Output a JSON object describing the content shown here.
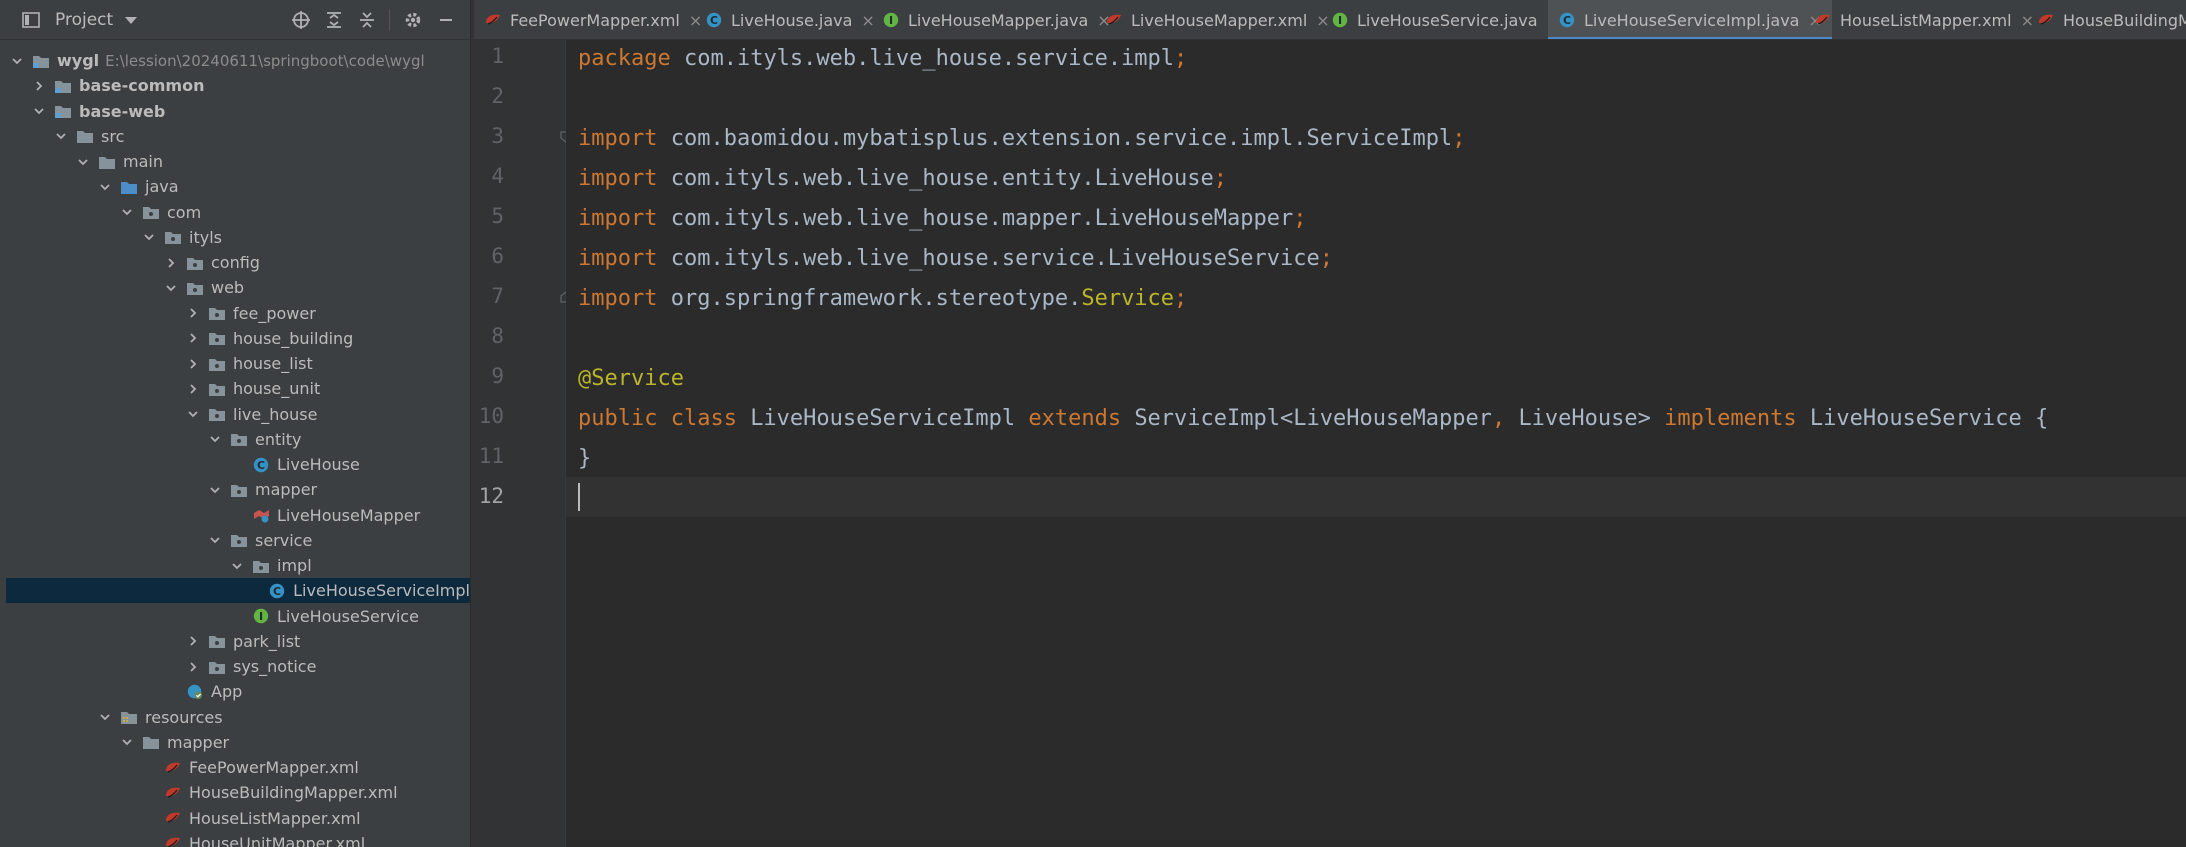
{
  "project_panel": {
    "title": "Project",
    "tree": [
      {
        "label": "wygl",
        "path": "E:\\lession\\20240611\\springboot\\code\\wygl",
        "bold": true,
        "expanded": true,
        "icon": "module-folder-icon"
      },
      {
        "label": "base-common",
        "bold": true,
        "expanded": false,
        "icon": "module-folder-icon"
      },
      {
        "label": "base-web",
        "bold": true,
        "expanded": true,
        "icon": "module-folder-icon"
      },
      {
        "label": "src",
        "expanded": true,
        "icon": "folder-icon"
      },
      {
        "label": "main",
        "expanded": true,
        "icon": "folder-icon"
      },
      {
        "label": "java",
        "expanded": true,
        "icon": "source-folder-icon"
      },
      {
        "label": "com",
        "expanded": true,
        "icon": "package-icon"
      },
      {
        "label": "ityls",
        "expanded": true,
        "icon": "package-icon"
      },
      {
        "label": "config",
        "expanded": false,
        "icon": "package-icon"
      },
      {
        "label": "web",
        "expanded": true,
        "icon": "package-icon"
      },
      {
        "label": "fee_power",
        "expanded": false,
        "icon": "package-icon"
      },
      {
        "label": "house_building",
        "expanded": false,
        "icon": "package-icon"
      },
      {
        "label": "house_list",
        "expanded": false,
        "icon": "package-icon"
      },
      {
        "label": "house_unit",
        "expanded": false,
        "icon": "package-icon"
      },
      {
        "label": "live_house",
        "expanded": true,
        "icon": "package-icon"
      },
      {
        "label": "entity",
        "expanded": true,
        "icon": "package-icon"
      },
      {
        "label": "LiveHouse",
        "icon": "java-class-icon"
      },
      {
        "label": "mapper",
        "expanded": true,
        "icon": "package-icon"
      },
      {
        "label": "LiveHouseMapper",
        "icon": "mapper-interface-icon"
      },
      {
        "label": "service",
        "expanded": true,
        "icon": "package-icon"
      },
      {
        "label": "impl",
        "expanded": true,
        "icon": "package-icon"
      },
      {
        "label": "LiveHouseServiceImpl",
        "icon": "java-class-icon",
        "selected": true
      },
      {
        "label": "LiveHouseService",
        "icon": "java-interface-icon"
      },
      {
        "label": "park_list",
        "expanded": false,
        "icon": "package-icon"
      },
      {
        "label": "sys_notice",
        "expanded": false,
        "icon": "package-icon"
      },
      {
        "label": "App",
        "icon": "spring-boot-app-icon"
      },
      {
        "label": "resources",
        "expanded": true,
        "icon": "resources-folder-icon"
      },
      {
        "label": "mapper",
        "expanded": true,
        "icon": "folder-icon"
      },
      {
        "label": "FeePowerMapper.xml",
        "icon": "mybatis-xml-icon"
      },
      {
        "label": "HouseBuildingMapper.xml",
        "icon": "mybatis-xml-icon"
      },
      {
        "label": "HouseListMapper.xml",
        "icon": "mybatis-xml-icon"
      },
      {
        "label": "HouseUnitMapper.xml",
        "icon": "mybatis-xml-icon"
      }
    ]
  },
  "editor_tabs": [
    {
      "label": "FeePowerMapper.xml",
      "icon": "mybatis-xml-icon"
    },
    {
      "label": "LiveHouse.java",
      "icon": "java-class-icon"
    },
    {
      "label": "LiveHouseMapper.java",
      "icon": "java-interface-icon"
    },
    {
      "label": "LiveHouseMapper.xml",
      "icon": "mybatis-xml-icon"
    },
    {
      "label": "LiveHouseService.java",
      "icon": "java-interface-icon"
    },
    {
      "label": "LiveHouseServiceImpl.java",
      "icon": "java-class-icon",
      "active": true
    },
    {
      "label": "HouseListMapper.xml",
      "icon": "mybatis-xml-icon"
    },
    {
      "label": "HouseBuildingMapper.xml",
      "icon": "mybatis-xml-icon"
    }
  ],
  "editor": {
    "current_line": 12,
    "lines": [
      {
        "n": "1",
        "tokens": [
          {
            "t": "package ",
            "c": "kw"
          },
          {
            "t": "com.ityls.web.live_house.service.impl",
            "c": "txt"
          },
          {
            "t": ";",
            "c": "punc"
          }
        ]
      },
      {
        "n": "2",
        "tokens": []
      },
      {
        "n": "3",
        "tokens": [
          {
            "t": "import ",
            "c": "kw"
          },
          {
            "t": "com.baomidou.mybatisplus.extension.service.impl.ServiceImpl",
            "c": "txt"
          },
          {
            "t": ";",
            "c": "punc"
          }
        ]
      },
      {
        "n": "4",
        "tokens": [
          {
            "t": "import ",
            "c": "kw"
          },
          {
            "t": "com.ityls.web.live_house.entity.LiveHouse",
            "c": "txt"
          },
          {
            "t": ";",
            "c": "punc"
          }
        ]
      },
      {
        "n": "5",
        "tokens": [
          {
            "t": "import ",
            "c": "kw"
          },
          {
            "t": "com.ityls.web.live_house.mapper.LiveHouseMapper",
            "c": "txt"
          },
          {
            "t": ";",
            "c": "punc"
          }
        ]
      },
      {
        "n": "6",
        "tokens": [
          {
            "t": "import ",
            "c": "kw"
          },
          {
            "t": "com.ityls.web.live_house.service.LiveHouseService",
            "c": "txt"
          },
          {
            "t": ";",
            "c": "punc"
          }
        ]
      },
      {
        "n": "7",
        "tokens": [
          {
            "t": "import ",
            "c": "kw"
          },
          {
            "t": "org.springframework.stereotype.",
            "c": "txt"
          },
          {
            "t": "Service",
            "c": "ann"
          },
          {
            "t": ";",
            "c": "punc"
          }
        ]
      },
      {
        "n": "8",
        "tokens": []
      },
      {
        "n": "9",
        "tokens": [
          {
            "t": "@Service",
            "c": "ann"
          }
        ]
      },
      {
        "n": "10",
        "tokens": [
          {
            "t": "public class ",
            "c": "kw"
          },
          {
            "t": "LiveHouseServiceImpl ",
            "c": "txt"
          },
          {
            "t": "extends ",
            "c": "kw"
          },
          {
            "t": "ServiceImpl<LiveHouseMapper",
            "c": "txt"
          },
          {
            "t": ", ",
            "c": "punc"
          },
          {
            "t": "LiveHouse> ",
            "c": "txt"
          },
          {
            "t": "implements ",
            "c": "kw"
          },
          {
            "t": "LiveHouseService {",
            "c": "txt"
          }
        ]
      },
      {
        "n": "11",
        "tokens": [
          {
            "t": "}",
            "c": "txt"
          }
        ]
      },
      {
        "n": "12",
        "tokens": []
      }
    ]
  },
  "colors": {
    "background": "#2b2b2b",
    "panel": "#3c3f41",
    "keyword": "#cc7832",
    "annotation": "#bbb529",
    "text": "#a9b7c6",
    "selection": "#0d293e",
    "active_tab_underline": "#4a88c7"
  }
}
